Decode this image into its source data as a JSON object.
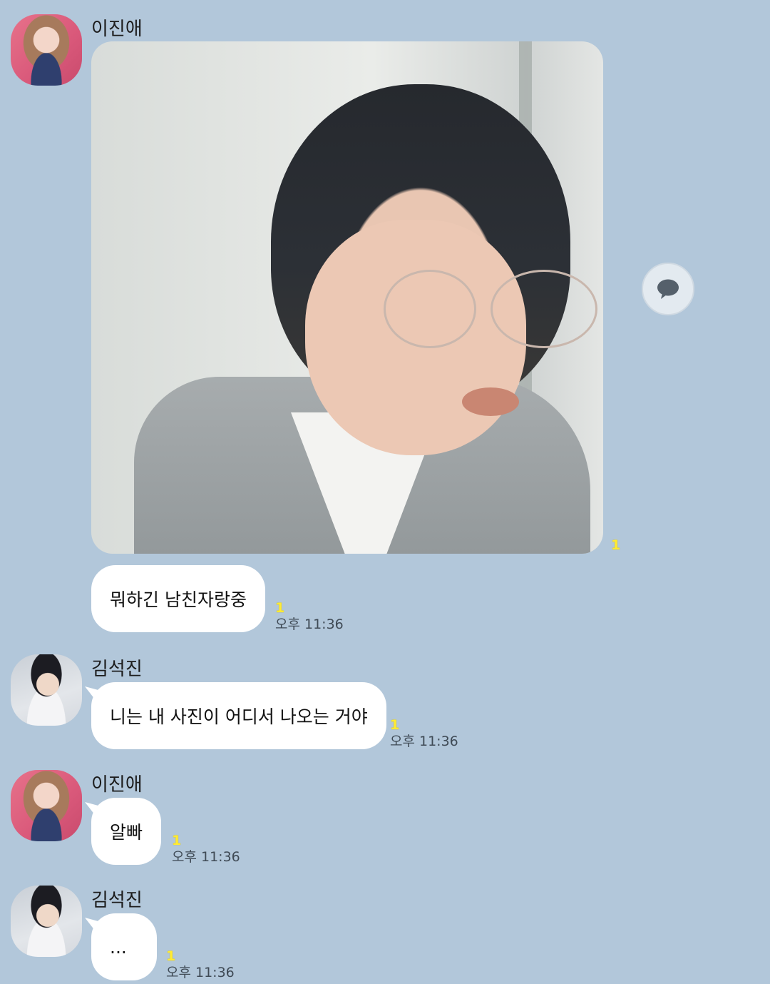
{
  "colors": {
    "background": "#b2c7da",
    "bubble": "#ffffff",
    "unread": "#ffeb33",
    "time": "#3f4a55"
  },
  "messages": [
    {
      "sender": "이진애",
      "avatar": "avatar-female",
      "type": "image",
      "unread": "1"
    },
    {
      "sender": "",
      "type": "text",
      "text": "뭐하긴 남친자랑중",
      "unread": "1",
      "time": "오후 11:36"
    },
    {
      "sender": "김석진",
      "avatar": "avatar-male",
      "type": "text",
      "text": "니는 내 사진이 어디서 나오는 거야",
      "unread": "1",
      "time": "오후 11:36"
    },
    {
      "sender": "이진애",
      "avatar": "avatar-female",
      "type": "text",
      "text": "알빠",
      "unread": "1",
      "time": "오후 11:36"
    },
    {
      "sender": "김석진",
      "avatar": "avatar-male",
      "type": "text",
      "text": "...",
      "unread": "1",
      "time": "오후 11:36"
    }
  ],
  "reply_button": {
    "icon": "speech-bubble-icon"
  }
}
